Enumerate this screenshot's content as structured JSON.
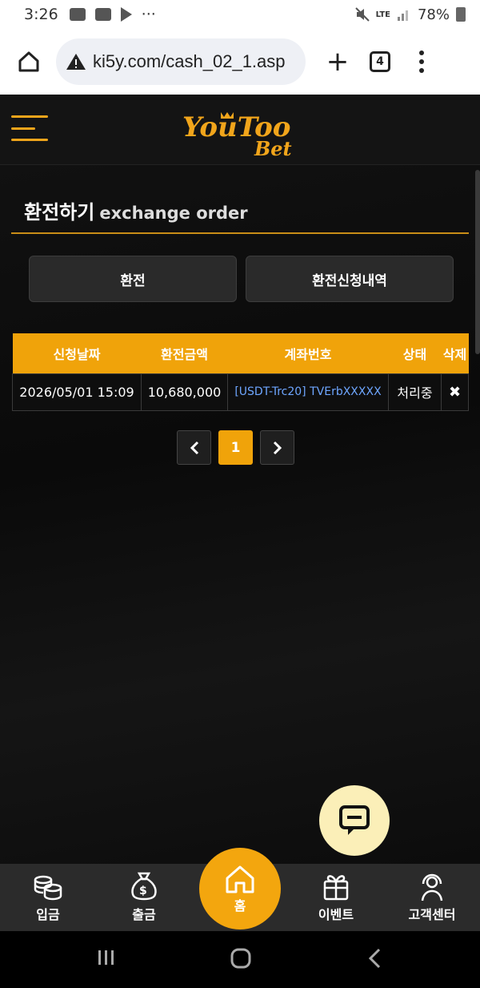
{
  "status_bar": {
    "time": "3:26",
    "signal_label": "LTE",
    "battery": "78%"
  },
  "browser": {
    "url": "ki5y.com/cash_02_1.asp",
    "tab_count": "4",
    "new_tab_label": "+"
  },
  "header": {
    "logo_line1": "YouToo",
    "logo_line2": "Bet",
    "accent_color": "#f1a51b"
  },
  "page": {
    "title": "환전하기",
    "subtitle": "exchange order"
  },
  "tabs": {
    "exchange_label": "환전",
    "history_label": "환전신청내역"
  },
  "table": {
    "headers": [
      "신청날짜",
      "환전금액",
      "계좌번호",
      "상태",
      "삭제"
    ],
    "rows": [
      {
        "date": "2026/05/01 15:09",
        "amount": "10,680,000",
        "account": "[USDT-Trc20] TVErbXXXXX",
        "status": "처리중",
        "delete": "✖"
      }
    ]
  },
  "pagination": {
    "prev": "‹",
    "current": "1",
    "next": "›"
  },
  "bottom_nav": {
    "deposit": "입금",
    "withdraw": "출금",
    "home": "홈",
    "event": "이벤트",
    "support": "고객센터"
  },
  "icons": {
    "chat": "chat-bubble-icon",
    "deposit": "coins-stack-icon",
    "withdraw": "money-bag-icon",
    "home": "house-icon",
    "event": "gift-box-icon",
    "support": "headset-person-icon"
  }
}
